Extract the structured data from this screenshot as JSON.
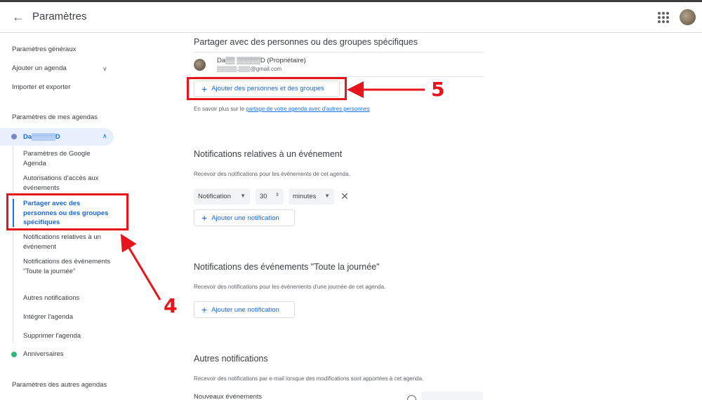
{
  "header": {
    "title": "Paramètres",
    "back_icon": "arrow-left-icon",
    "apps_icon": "apps-grid-icon"
  },
  "sidebar": {
    "general": "Paramètres généraux",
    "add_calendar": "Ajouter un agenda",
    "import_export": "Importer et exporter",
    "my_calendars_heading": "Paramètres de mes agendas",
    "calendar_name": "Da▒▒▒▒▒D",
    "calendar_color": "#7986cb",
    "sub_items": [
      "Paramètres de Google Agenda",
      "Autorisations d'accès aux événements",
      "Partager avec des personnes ou des groupes spécifiques",
      "Notifications relatives à un événement",
      "Notifications des événements \"Toute la journée\"",
      "Autres notifications",
      "Intégrer l'agenda",
      "Supprimer l'agenda"
    ],
    "birthdays": "Anniversaires",
    "birthdays_color": "#33b679",
    "other_calendars_heading": "Paramètres des autres agendas"
  },
  "share": {
    "heading": "Partager avec des personnes ou des groupes spécifiques",
    "owner_name": "Da▒▒ ▒▒▒▒▒D (Propriétaire)",
    "owner_email": "▒▒▒▒▒.▒▒▒@gmail.com",
    "add_button": "Ajouter des personnes et des groupes",
    "learn_prefix": "En savoir plus sur le ",
    "learn_link": "partage de votre agenda avec d'autres personnes"
  },
  "event_notifications": {
    "heading": "Notifications relatives à un événement",
    "description": "Recevoir des notifications pour les événements de cet agenda.",
    "type_value": "Notification",
    "amount_value": "30",
    "unit_value": "minutes",
    "add_button": "Ajouter une notification"
  },
  "allday_notifications": {
    "heading": "Notifications des événements \"Toute la journée\"",
    "description": "Recevoir des notifications pour les événements d'une journée de cet agenda.",
    "add_button": "Ajouter une notification"
  },
  "other_notifications": {
    "heading": "Autres notifications",
    "description": "Recevoir des notifications par e-mail lorsque des modifications sont apportées à cet agenda.",
    "new_events": "Nouveaux événements"
  },
  "annotations": {
    "label_4": "4",
    "label_5": "5",
    "color": "#e8141b"
  }
}
